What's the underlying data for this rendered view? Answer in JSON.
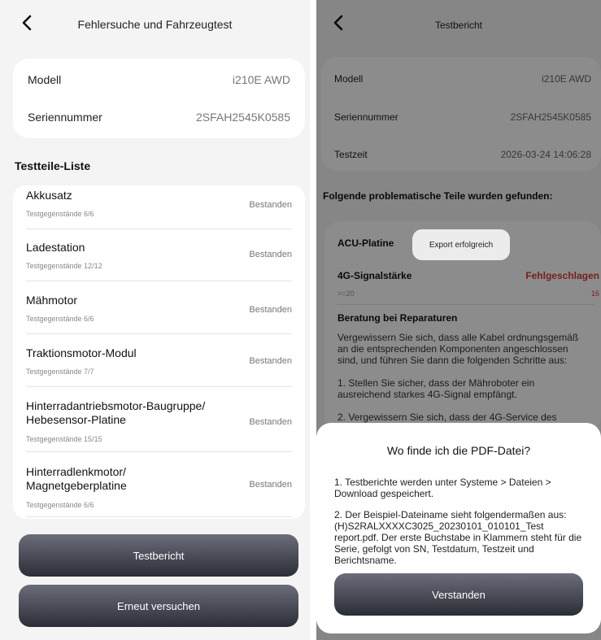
{
  "left": {
    "title": "Fehlersuche und Fahrzeugtest",
    "info": {
      "model_label": "Modell",
      "model_value": "i210E AWD",
      "serial_label": "Seriennummer",
      "serial_value": "2SFAH2545K0585"
    },
    "section_title": "Testteile-Liste",
    "items": [
      {
        "name": "Akkusatz",
        "sub": "Testgegenstände 6/6",
        "status": "Bestanden"
      },
      {
        "name": "Ladestation",
        "sub": "Testgegenstände 12/12",
        "status": "Bestanden"
      },
      {
        "name": "Mähmotor",
        "sub": "Testgegenstände 6/6",
        "status": "Bestanden"
      },
      {
        "name": "Traktionsmotor-Modul",
        "sub": "Testgegenstände 7/7",
        "status": "Bestanden"
      },
      {
        "name": "Hinterradantriebsmotor-Baugruppe/\nHebesensor-Platine",
        "sub": "Testgegenstände 15/15",
        "status": "Bestanden"
      },
      {
        "name": "Hinterradlenkmotor/\nMagnetgeberplatine",
        "sub": "Testgegenstände 6/6",
        "status": "Bestanden"
      }
    ],
    "buttons": {
      "report": "Testbericht",
      "retry": "Erneut versuchen"
    }
  },
  "right": {
    "title": "Testbericht",
    "info": {
      "model_label": "Modell",
      "model_value": "i210E AWD",
      "serial_label": "Seriennummer",
      "serial_value": "2SFAH2545K0585",
      "time_label": "Testzeit",
      "time_value": "2026-03-24 14:06:28"
    },
    "problem_heading": "Folgende problematische Teile wurden gefunden:",
    "part_name": "ACU-Platine",
    "toast": "Export erfolgreich",
    "signal_label": "4G-Signalstärke",
    "signal_status": "Fehlgeschlagen",
    "signal_expected": ">=20",
    "signal_value": "16",
    "advice_heading": "Beratung bei Reparaturen",
    "advice_text": "Vergewissern Sie sich, dass alle Kabel ordnungsgemäß an die entsprechenden Komponenten angeschlossen sind, und führen Sie dann die folgenden Schritte aus:",
    "step1": "1. Stellen Sie sicher, dass der Mähroboter ein ausreichend starkes 4G-Signal empfängt.",
    "step2": "2. Vergewissern Sie sich, dass der 4G-Service des",
    "sheet": {
      "title": "Wo finde ich die PDF-Datei?",
      "para1": "1. Testberichte werden unter Systeme > Dateien > Download gespeichert.",
      "para2": "2. Der Beispiel-Dateiname sieht folgendermaßen aus: (H)S2RALXXXXC3025_20230101_010101_Test report.pdf. Der erste Buchstabe in Klammern steht für die Serie, gefolgt von SN, Testdatum, Testzeit und Berichtsname.",
      "button": "Verstanden"
    }
  },
  "colors": {
    "fail": "#d93a3a",
    "button_gradient_top": "#6b6d7a",
    "button_gradient_bottom": "#2b2d36"
  }
}
